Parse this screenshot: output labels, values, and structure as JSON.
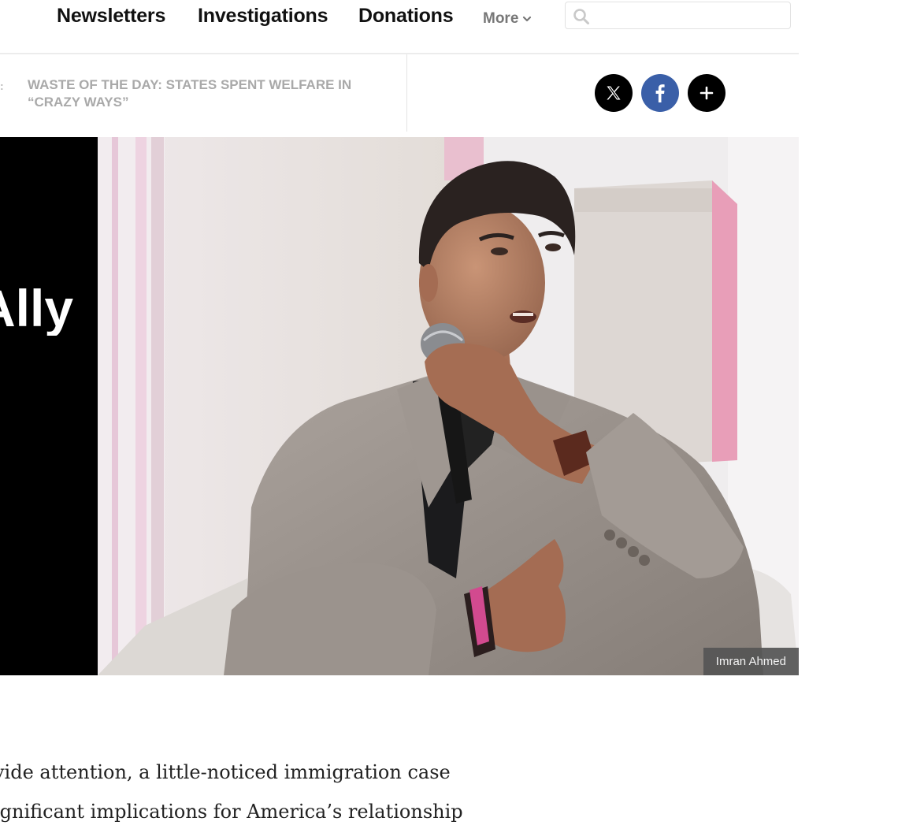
{
  "nav": {
    "links": [
      "Newsletters",
      "Investigations",
      "Donations"
    ],
    "more_label": "More",
    "search_placeholder": ""
  },
  "ticker": {
    "headline": "WASTE OF THE DAY: STATES SPENT WELFARE IN “CRAZY WAYS”",
    "share": {
      "x_label": "X",
      "facebook_label": "f",
      "more_label": "+"
    }
  },
  "hero": {
    "headline_fragment": "Ally",
    "caption": "Imran Ahmed"
  },
  "article": {
    "lines": [
      "vide attention, a little-noticed immigration case",
      "ignificant implications for America’s relationship"
    ]
  },
  "colors": {
    "nav_text": "#111111",
    "ticker_text": "#a9a9a9",
    "facebook_blue": "#3a5fa8",
    "caption_bg": "#555555"
  }
}
